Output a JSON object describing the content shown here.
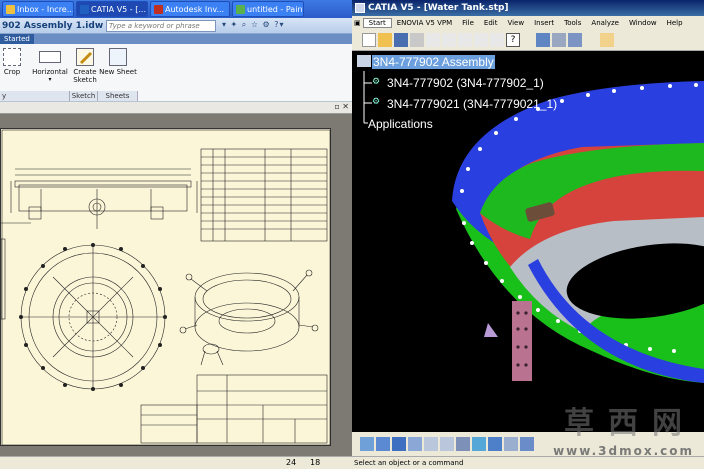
{
  "taskbar": {
    "items": [
      {
        "label": "Inbox - Incre...",
        "color": "#f0c040"
      },
      {
        "label": "CATIA V5 - [...",
        "color": "#1f60c0"
      },
      {
        "label": "Autodesk Inv...",
        "color": "#c03020"
      },
      {
        "label": "untitled - Paint",
        "color": "#5ab04a"
      }
    ]
  },
  "inventor": {
    "title": "902 Assembly 1.idw",
    "search_placeholder": "Type a keyword or phrase",
    "ribbon_tab": "Started",
    "buttons": {
      "crop": "Crop",
      "horizontal": "Horizontal",
      "create_sketch_line1": "Create",
      "create_sketch_line2": "Sketch",
      "new_sheet": "New Sheet"
    },
    "groups": {
      "view": "y",
      "sketch": "Sketch",
      "sheets": "Sheets"
    },
    "status": {
      "num1": "24",
      "num2": "18"
    }
  },
  "catia": {
    "title": "CATIA V5 - [Water Tank.stp]",
    "menu": [
      "Start",
      "ENOVIA V5 VPM",
      "File",
      "Edit",
      "View",
      "Insert",
      "Tools",
      "Analyze",
      "Window",
      "Help"
    ],
    "tree": {
      "root": "3N4-777902 Assembly",
      "child1": "3N4-777902 (3N4-777902_1)",
      "child2": "3N4-7779021 (3N4-7779021_1)",
      "applications": "Applications"
    },
    "status": "Select an object or a command"
  },
  "watermark": {
    "chars": "草西网",
    "url": "www.3dmox.com"
  },
  "colors": {
    "flange": "#2a3fe0",
    "shell": "#19c01a",
    "inner": "#d6433c",
    "ring": "#b8bec6",
    "bracket": "#b9728f",
    "sheet_bg": "#fbf6d8"
  }
}
